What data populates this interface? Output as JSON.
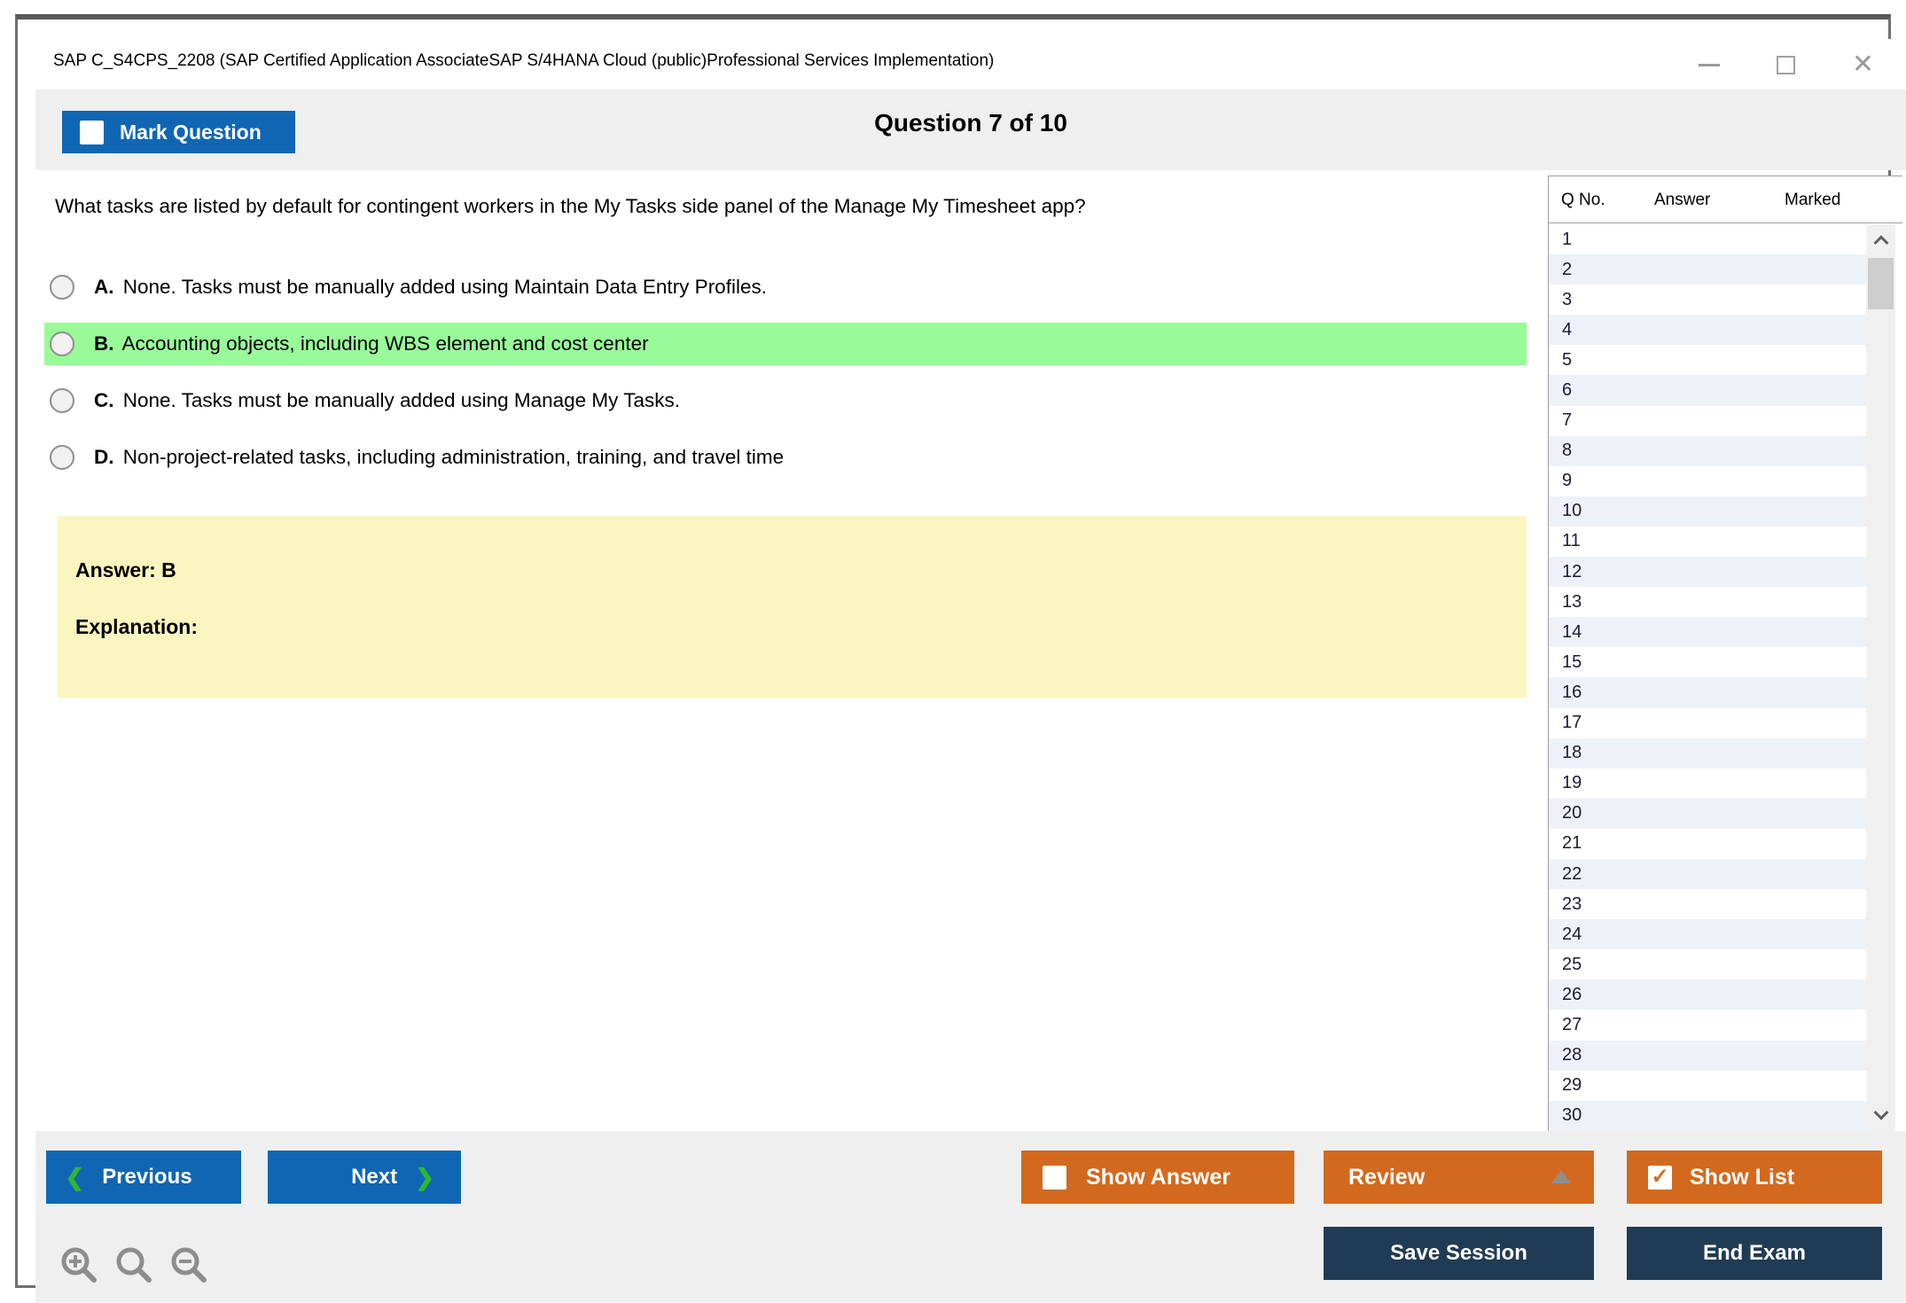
{
  "window": {
    "title": "SAP C_S4CPS_2208 (SAP Certified Application AssociateSAP S/4HANA Cloud (public)Professional Services Implementation)"
  },
  "header": {
    "mark_question_label": "Mark Question",
    "question_counter": "Question 7 of 10"
  },
  "question": {
    "text": "What tasks are listed by default for contingent workers in the My Tasks side panel of the Manage My Timesheet app?",
    "options": [
      {
        "letter": "A.",
        "text": "None. Tasks must be manually added using Maintain Data Entry Profiles.",
        "highlighted": false
      },
      {
        "letter": "B.",
        "text": "Accounting objects, including WBS element and cost center",
        "highlighted": true
      },
      {
        "letter": "C.",
        "text": "None. Tasks must be manually added using Manage My Tasks.",
        "highlighted": false
      },
      {
        "letter": "D.",
        "text": "Non-project-related tasks, including administration, training, and travel time",
        "highlighted": false
      }
    ],
    "answer_label": "Answer: B",
    "explanation_label": "Explanation:"
  },
  "question_list": {
    "columns": [
      "Q No.",
      "Answer",
      "Marked"
    ],
    "rows": [
      "1",
      "2",
      "3",
      "4",
      "5",
      "6",
      "7",
      "8",
      "9",
      "10",
      "11",
      "12",
      "13",
      "14",
      "15",
      "16",
      "17",
      "18",
      "19",
      "20",
      "21",
      "22",
      "23",
      "24",
      "25",
      "26",
      "27",
      "28",
      "29",
      "30"
    ]
  },
  "footer": {
    "previous_label": "Previous",
    "next_label": "Next",
    "show_answer_label": "Show Answer",
    "review_label": "Review",
    "show_list_label": "Show List",
    "save_session_label": "Save Session",
    "end_exam_label": "End Exam",
    "show_list_checked": "✓"
  },
  "colors": {
    "primary_blue": "#1066b3",
    "accent_orange": "#d2691e",
    "dark_navy": "#203c55",
    "highlight_green": "#98fb98",
    "answer_yellow": "#faf5be",
    "chevron_green": "#2eb82e",
    "alt_row_blue": "#edf2f8",
    "chrome_gray": "#efefef"
  }
}
